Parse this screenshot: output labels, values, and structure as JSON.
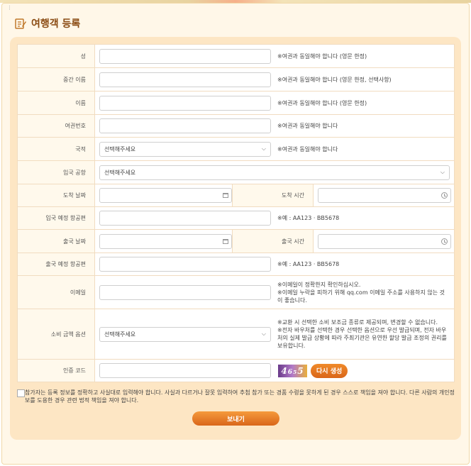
{
  "page": {
    "title": "여행객 등록"
  },
  "form": {
    "surname": {
      "label": "성",
      "value": "",
      "note": "※여권과 동일해야 합니다 (영문 한정)"
    },
    "middle_name": {
      "label": "중간 이름",
      "value": "",
      "note": "※여권과 동일해야 합니다 (영문 한정, 선택사항)"
    },
    "given_name": {
      "label": "이름",
      "value": "",
      "note": "※여권과 동일해야 합니다 (영문 한정)"
    },
    "passport_no": {
      "label": "여권번호",
      "value": "",
      "note": "※여권과 동일해야 합니다"
    },
    "nationality": {
      "label": "국적",
      "selected": "선택해주세요",
      "note": "※여권과 동일해야 합니다"
    },
    "entry_airport": {
      "label": "입국 공항",
      "selected": "선택해주세요"
    },
    "arrival_date": {
      "label": "도착 날짜",
      "value": ""
    },
    "arrival_time": {
      "label": "도착 시간",
      "value": ""
    },
    "entry_flight": {
      "label": "입국 예정 항공편",
      "value": "",
      "note": "※예 : AA123 · BB5678"
    },
    "departure_date": {
      "label": "출국 날짜",
      "value": ""
    },
    "departure_time": {
      "label": "출국 시간",
      "value": ""
    },
    "exit_flight": {
      "label": "출국 예정 항공편",
      "value": "",
      "note": "※예 : AA123 · BB5678"
    },
    "email": {
      "label": "이메일",
      "value": "",
      "note1": "※이메일이 정확한지 확인하십시오.",
      "note2": "※이메일 누락을 피하기 위해 qq.com 이메일 주소를 사용하지 않는 것이 좋습니다."
    },
    "amount_option": {
      "label": "소비 금액 옵션",
      "selected": "선택해주세요",
      "note1": "※교환 시 선택한 소비 보조금 종류로 제공되며, 변경할 수 없습니다.",
      "note2": "※전자 바우처를 선택한 경우 선택한 옵션으로 우선 발급되며, 전자 바우처의 실제 발급 상황에 따라 주최기관은 유연한 할당 발급 조정의 권리를 보유합니다."
    },
    "captcha": {
      "label": "인증 코드",
      "value": "",
      "image_text": "46₅5",
      "regen_label": "다시 생성"
    }
  },
  "agreement": {
    "checked": false,
    "text": "참가자는 등록 정보를 정확하고 사실대로 입력해야 합니다. 사실과 다르거나 잘못 입력하여 추첨 참가 또는 경품 수령을 못하게 된 경우 스스로 책임을 져야 합니다. 다른 사람의 개인정보를 도용한 경우 관련 법적 책임을 져야 합니다."
  },
  "submit_label": "보내기",
  "colors": {
    "accent": "#e07820",
    "panel": "#fde6c4",
    "title": "#8a4b12"
  }
}
